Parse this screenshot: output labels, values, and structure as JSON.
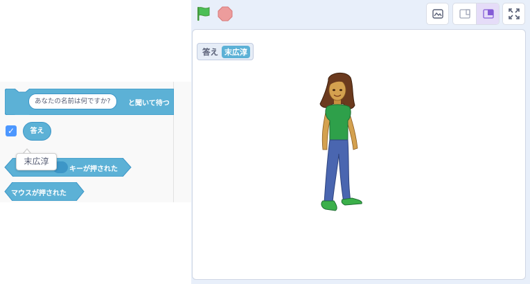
{
  "palette": {
    "ask_block": {
      "question": "あなたの名前は何ですか?",
      "suffix": "と聞いて待つ"
    },
    "answer_reporter": {
      "label": "答え",
      "checked": true
    },
    "key_pressed_block": {
      "suffix": "キーが押された"
    },
    "mouse_down_block": {
      "label": "マウスが押された"
    },
    "answer_tooltip": {
      "value": "末広淳"
    }
  },
  "toolbar": {
    "green_flag_icon": "green-flag-icon",
    "stop_icon": "stop-icon",
    "buttons": [
      "fullscreen-editor-icon",
      "small-stage-icon",
      "large-stage-icon",
      "fullscreen-icon"
    ]
  },
  "stage": {
    "answer_monitor": {
      "label": "答え",
      "value": "末広淳"
    },
    "sprite": "girl-sprite"
  },
  "colors": {
    "sensing_block": "#5cb1d6",
    "sensing_block_border": "#3d96c7",
    "checkbox": "#4c97ff",
    "stage_area_bg": "#e8effa",
    "selected_layout": "#e5dcf8",
    "green_flag": "#4cbf56",
    "stop": "#ec9c9c"
  }
}
